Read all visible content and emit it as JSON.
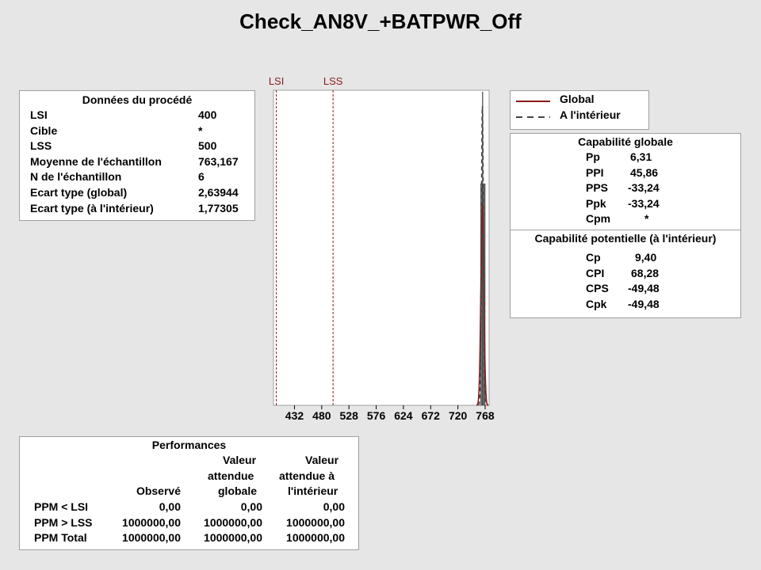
{
  "title": "Check_AN8V_+BATPWR_Off",
  "process_data": {
    "header": "Données du procédé",
    "rows": [
      {
        "label": "LSI",
        "value": "400"
      },
      {
        "label": "Cible",
        "value": "*"
      },
      {
        "label": "LSS",
        "value": "500"
      },
      {
        "label": "Moyenne de l'échantillon",
        "value": "763,167"
      },
      {
        "label": "N de l'échantillon",
        "value": "6"
      },
      {
        "label": "Ecart type (global)",
        "value": "2,63944"
      },
      {
        "label": "Ecart type (à l'intérieur)",
        "value": "1,77305"
      }
    ]
  },
  "legend": {
    "items": [
      {
        "label": "Global",
        "color": "#8b1a1a",
        "style": "solid"
      },
      {
        "label": "A l'intérieur",
        "color": "#444444",
        "style": "dashed"
      }
    ]
  },
  "capability": {
    "overall_header": "Capabilité globale",
    "overall": [
      {
        "label": "Pp",
        "value": "6,31"
      },
      {
        "label": "PPI",
        "value": "45,86"
      },
      {
        "label": "PPS",
        "value": "-33,24"
      },
      {
        "label": "Ppk",
        "value": "-33,24"
      },
      {
        "label": "Cpm",
        "value": "*"
      }
    ],
    "potential_header": "Capabilité potentielle (à l'intérieur)",
    "potential": [
      {
        "label": "Cp",
        "value": "9,40"
      },
      {
        "label": "CPI",
        "value": "68,28"
      },
      {
        "label": "CPS",
        "value": "-49,48"
      },
      {
        "label": "Cpk",
        "value": "-49,48"
      }
    ]
  },
  "performance": {
    "header": "Performances",
    "col_headers": [
      [
        "",
        "",
        "Observé"
      ],
      [
        "Valeur",
        "attendue",
        "globale"
      ],
      [
        "Valeur",
        "attendue à",
        "l'intérieur"
      ]
    ],
    "rows": [
      {
        "label": "PPM < LSI",
        "values": [
          "0,00",
          "0,00",
          "0,00"
        ]
      },
      {
        "label": "PPM > LSS",
        "values": [
          "1000000,00",
          "1000000,00",
          "1000000,00"
        ]
      },
      {
        "label": "PPM Total",
        "values": [
          "1000000,00",
          "1000000,00",
          "1000000,00"
        ]
      }
    ]
  },
  "chart_data": {
    "type": "bar",
    "title": "",
    "xlim": [
      395,
      775
    ],
    "x_ticks": [
      432,
      480,
      528,
      576,
      624,
      672,
      720,
      768
    ],
    "spec_lines": [
      {
        "label": "LSI",
        "value": 400
      },
      {
        "label": "LSS",
        "value": 500
      }
    ],
    "histogram": {
      "bin_centers": [
        760.5,
        761.5,
        762.5,
        763.5,
        764.5,
        765.5,
        766.5,
        767.5,
        768.5
      ],
      "bin_width": 1.0,
      "counts": [
        1,
        0,
        1,
        2,
        0,
        1,
        0,
        1,
        0
      ]
    },
    "curves": [
      {
        "name": "Global",
        "mean": 763.167,
        "sd": 2.63944,
        "color": "#8b1a1a",
        "dash": false
      },
      {
        "name": "A l'intérieur",
        "mean": 763.167,
        "sd": 1.77305,
        "color": "#444444",
        "dash": true
      }
    ],
    "grid": false,
    "legend_position": "top-right"
  },
  "colors": {
    "background": "#e6e6e6",
    "spec_line": "#8b1a1a",
    "histogram_bar": "#666666"
  }
}
